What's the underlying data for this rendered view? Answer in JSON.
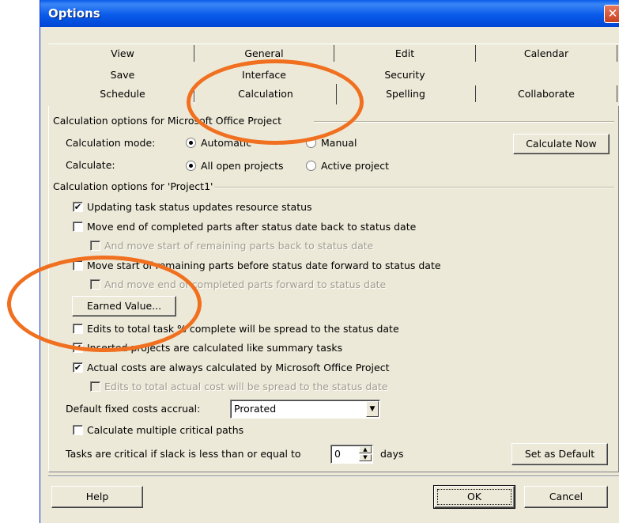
{
  "window": {
    "title": "Options",
    "close_glyph": "✕"
  },
  "tabs": {
    "row1": [
      "View",
      "General",
      "Edit",
      "Calendar"
    ],
    "row2": [
      "Save",
      "Interface",
      "Security"
    ],
    "row3": [
      "Schedule",
      "Calculation",
      "Spelling",
      "Collaborate"
    ],
    "selected": "Calculation"
  },
  "calc_group": {
    "title": "Calculation options for Microsoft Office Project",
    "mode_label": "Calculation mode:",
    "mode_automatic": "Automatic",
    "mode_manual": "Manual",
    "mode_selected": "Automatic",
    "calculate_label": "Calculate:",
    "calc_all": "All open projects",
    "calc_active": "Active project",
    "calc_selected": "All open projects",
    "calculate_now_button": "Calculate Now"
  },
  "project_group": {
    "title": "Calculation options for 'Project1'",
    "opt_updating": {
      "label": "Updating task status updates resource status",
      "checked": true
    },
    "opt_move_end": {
      "label": "Move end of completed parts after status date back to status date",
      "checked": false
    },
    "opt_move_start_back": {
      "label": "And move start of remaining parts back to status date",
      "checked": false,
      "disabled": true
    },
    "opt_move_start_fwd": {
      "label": "Move start of remaining parts before status date forward to status date",
      "checked": false
    },
    "opt_move_end_fwd": {
      "label": "And move end of completed parts forward to status date",
      "checked": false,
      "disabled": true
    },
    "earned_value_button": "Earned Value...",
    "opt_edits_spread": {
      "label": "Edits to total task % complete will be spread to the status date",
      "checked": false
    },
    "opt_inserted": {
      "label": "Inserted projects are calculated like summary tasks",
      "checked": true
    },
    "opt_actual_costs": {
      "label": "Actual costs are always calculated by Microsoft Office Project",
      "checked": true
    },
    "opt_actual_cost_spread": {
      "label": "Edits to total actual cost will be spread to the status date",
      "checked": false,
      "disabled": true
    },
    "fixed_costs_label": "Default fixed costs accrual:",
    "fixed_costs_value": "Prorated",
    "opt_multiple_paths": {
      "label": "Calculate multiple critical paths",
      "checked": false
    },
    "slack_label": "Tasks are critical if slack is less than or equal to",
    "slack_value": "0",
    "slack_unit": "days",
    "set_default_button": "Set as Default"
  },
  "footer": {
    "help_button": "Help",
    "ok_button": "OK",
    "cancel_button": "Cancel"
  },
  "colors": {
    "annotation": "#f07020",
    "titlebar": "#0a5bea",
    "dialog_bg": "#ece9d8"
  },
  "checkmark": "✔"
}
